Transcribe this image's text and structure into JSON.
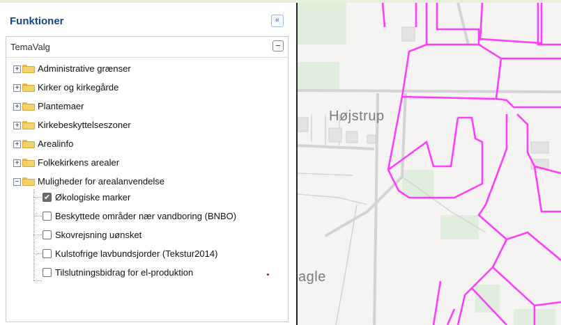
{
  "panel": {
    "title": "Funktioner",
    "collapse_icon": "double-chevron-left-icon",
    "collapse_glyph": "«"
  },
  "section": {
    "title": "TemaValg",
    "minus_glyph": "−"
  },
  "tree": {
    "folders": [
      {
        "label": "Administrative grænser",
        "expanded": false
      },
      {
        "label": "Kirker og kirkegårde",
        "expanded": false
      },
      {
        "label": "Plantemaer",
        "expanded": false
      },
      {
        "label": "Kirkebeskyttelseszoner",
        "expanded": false
      },
      {
        "label": "Arealinfo",
        "expanded": false
      },
      {
        "label": "Folkekirkens arealer",
        "expanded": false
      },
      {
        "label": "Muligheder for arealanvendelse",
        "expanded": true
      }
    ],
    "layers": [
      {
        "label": "Økologiske marker",
        "checked": true
      },
      {
        "label": "Beskyttede områder nær vandboring (BNBO)",
        "checked": false
      },
      {
        "label": "Skovrejsning uønsket",
        "checked": false
      },
      {
        "label": "Kulstofrige lavbundsjorder (Tekstur2014)",
        "checked": false
      },
      {
        "label": "Tilslutningsbidrag for el-produktion",
        "checked": false
      }
    ],
    "plus_glyph": "+",
    "minus_glyph": "−",
    "check_glyph": "✔"
  },
  "map": {
    "place_label": "Højstrup",
    "place_label_partial": "agle",
    "parcel_color": "#ff3dff",
    "road_color": "#d6d6d6",
    "green_color": "#dfeedd"
  }
}
